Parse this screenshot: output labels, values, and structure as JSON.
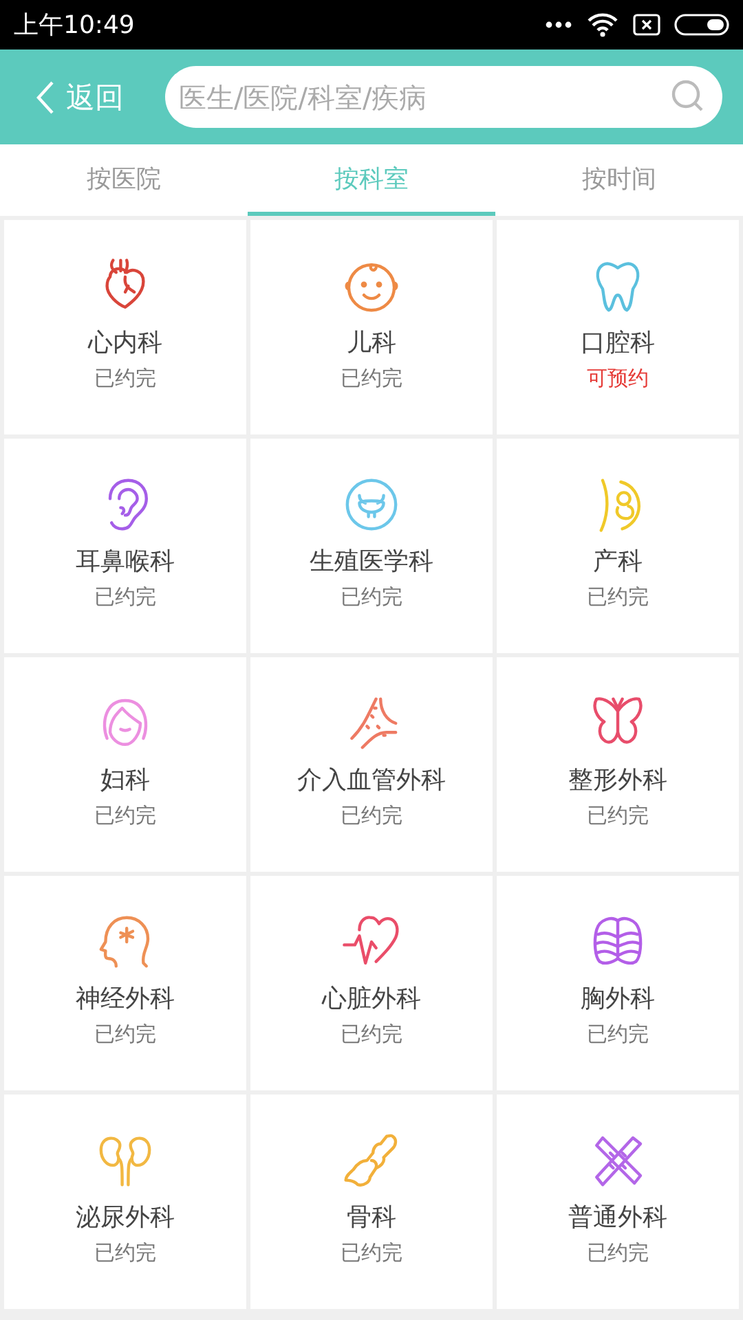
{
  "status_bar": {
    "time": "上午10:49"
  },
  "header": {
    "back": "返回",
    "search": {
      "placeholder": "医生/医院/科室/疾病"
    }
  },
  "tabs": [
    {
      "label": "按医院",
      "selected": false
    },
    {
      "label": "按科室",
      "selected": true
    },
    {
      "label": "按时间",
      "selected": false
    }
  ],
  "departments": [
    {
      "name": "心内科",
      "status": "已约完",
      "available": false,
      "kind": "heart",
      "color": "#d9453a"
    },
    {
      "name": "儿科",
      "status": "已约完",
      "available": false,
      "kind": "baby",
      "color": "#ee8a45"
    },
    {
      "name": "口腔科",
      "status": "可预约",
      "available": true,
      "kind": "tooth",
      "color": "#5bc0de"
    },
    {
      "name": "耳鼻喉科",
      "status": "已约完",
      "available": false,
      "kind": "ear",
      "color": "#a55ee8"
    },
    {
      "name": "生殖医学科",
      "status": "已约完",
      "available": false,
      "kind": "uterus",
      "color": "#6cc7ea"
    },
    {
      "name": "产科",
      "status": "已约完",
      "available": false,
      "kind": "pregnancy",
      "color": "#f0c929"
    },
    {
      "name": "妇科",
      "status": "已约完",
      "available": false,
      "kind": "woman",
      "color": "#ec8fe0"
    },
    {
      "name": "介入血管外科",
      "status": "已约完",
      "available": false,
      "kind": "vessel",
      "color": "#ee7a63"
    },
    {
      "name": "整形外科",
      "status": "已约完",
      "available": false,
      "kind": "butterfly",
      "color": "#e84d6b"
    },
    {
      "name": "神经外科",
      "status": "已约完",
      "available": false,
      "kind": "brain",
      "color": "#ee9055"
    },
    {
      "name": "心脏外科",
      "status": "已约完",
      "available": false,
      "kind": "heartbeat",
      "color": "#ea4d69"
    },
    {
      "name": "胸外科",
      "status": "已约完",
      "available": false,
      "kind": "ribs",
      "color": "#b35ee8"
    },
    {
      "name": "泌尿外科",
      "status": "已约完",
      "available": false,
      "kind": "kidney",
      "color": "#f2b842"
    },
    {
      "name": "骨科",
      "status": "已约完",
      "available": false,
      "kind": "bone",
      "color": "#f2b03a"
    },
    {
      "name": "普通外科",
      "status": "已约完",
      "available": false,
      "kind": "bandage",
      "color": "#b366e8"
    }
  ]
}
